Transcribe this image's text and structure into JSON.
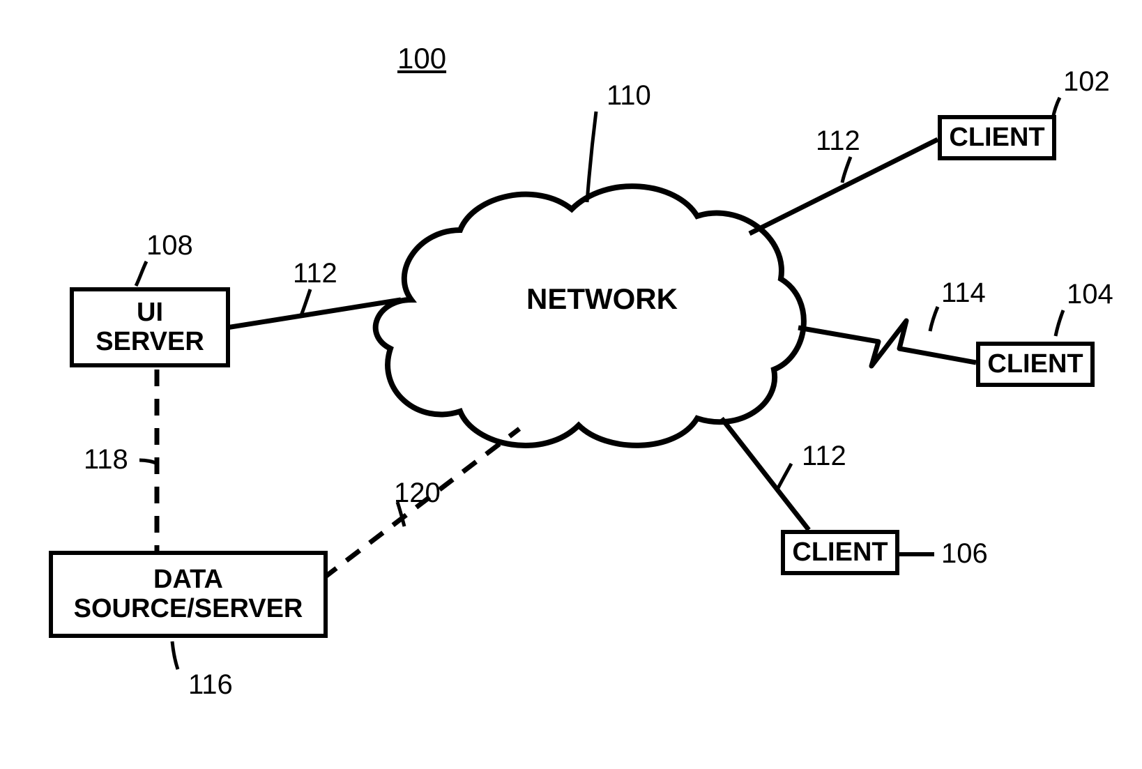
{
  "figure_number": "100",
  "network": {
    "label": "NETWORK",
    "ref": "110"
  },
  "nodes": {
    "ui_server": {
      "label": "UI\nSERVER",
      "ref": "108"
    },
    "data_source": {
      "label": "DATA\nSOURCE/SERVER",
      "ref": "116"
    },
    "client_top": {
      "label": "CLIENT",
      "ref": "102"
    },
    "client_right": {
      "label": "CLIENT",
      "ref": "104"
    },
    "client_bottom": {
      "label": "CLIENT",
      "ref": "106"
    }
  },
  "links": {
    "wired_client_top": "112",
    "wired_ui_server": "112",
    "wired_client_bottom": "112",
    "wireless_client_right": "114",
    "dashed_ui_data": "118",
    "dashed_data_network": "120"
  }
}
